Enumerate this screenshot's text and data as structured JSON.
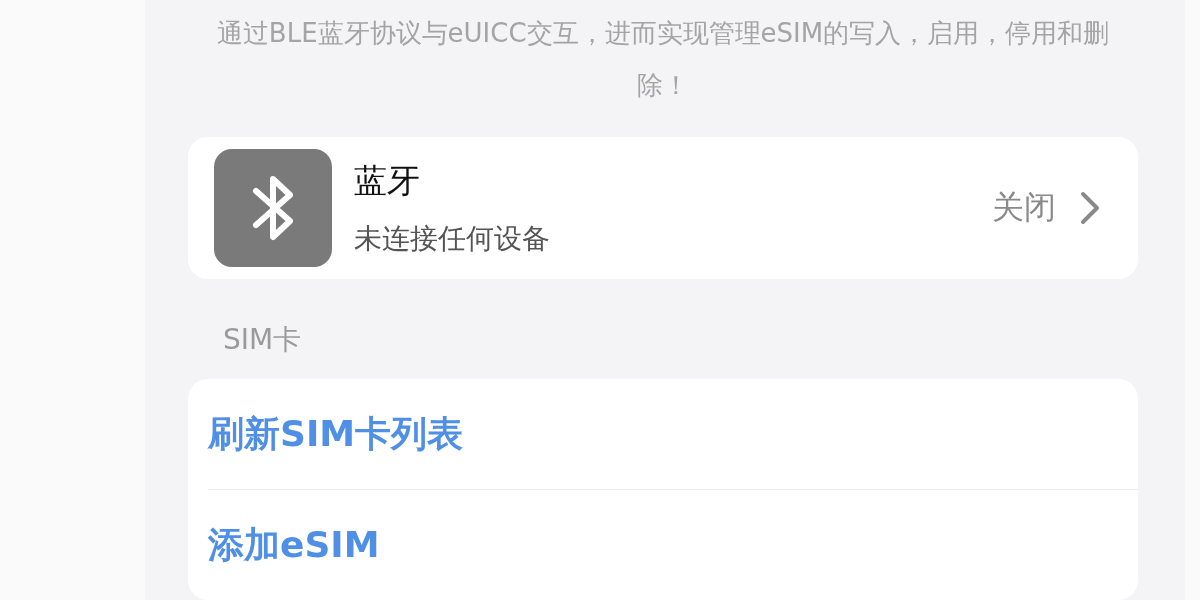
{
  "description": "通过BLE蓝牙协议与eUICC交互，进而实现管理eSIM的写入，启用，停用和删除！",
  "bluetooth": {
    "title": "蓝牙",
    "status": "未连接任何设备",
    "state_label": "关闭"
  },
  "sim_section": {
    "header": "SIM卡",
    "actions": [
      {
        "label": "刷新SIM卡列表"
      },
      {
        "label": "添加eSIM"
      }
    ]
  }
}
